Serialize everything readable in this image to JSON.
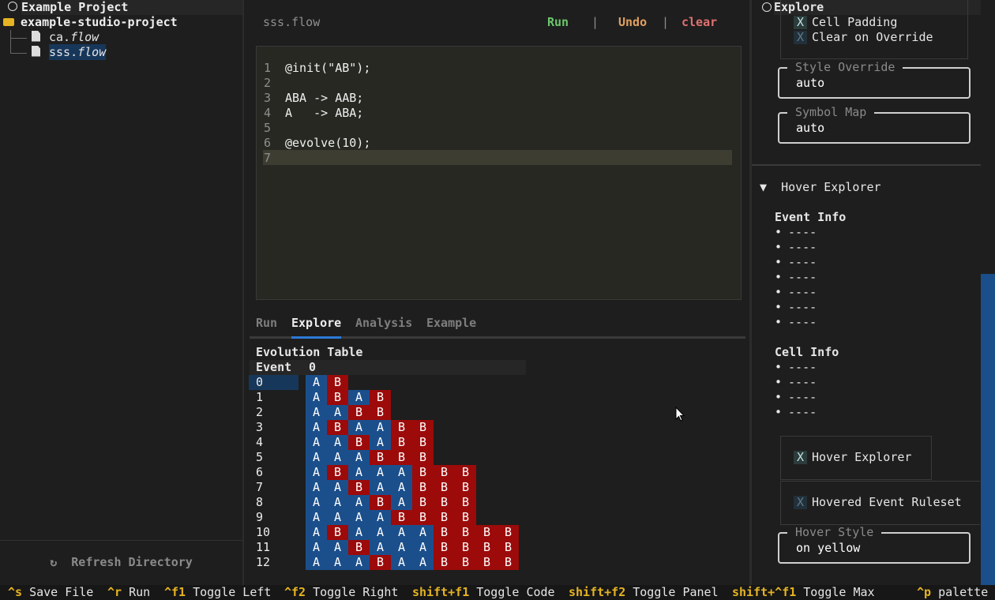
{
  "left": {
    "title": "Example Project",
    "project_folder": "example-studio-project",
    "files": [
      {
        "stem": "ca.",
        "ext": "flow"
      },
      {
        "stem": "sss.",
        "ext": "flow"
      }
    ],
    "refresh_label": "Refresh Directory",
    "refresh_icon": "↻"
  },
  "editor": {
    "filename": "sss.flow",
    "run_label": "Run",
    "separator": "|",
    "undo_label": "Undo",
    "clear_label": "clear",
    "lines": [
      {
        "num": "1",
        "text": "@init(\"AB\");"
      },
      {
        "num": "2",
        "text": ""
      },
      {
        "num": "3",
        "text": "ABA -> AAB;"
      },
      {
        "num": "4",
        "text": "A   -> ABA;"
      },
      {
        "num": "5",
        "text": ""
      },
      {
        "num": "6",
        "text": "@evolve(10);"
      },
      {
        "num": "7",
        "text": ""
      }
    ]
  },
  "tabs": [
    "Run",
    "Explore",
    "Analysis",
    "Example"
  ],
  "active_tab": "Explore",
  "evolution": {
    "title": "Evolution Table",
    "col_event": "Event",
    "col_state": "0",
    "rows": [
      {
        "event": "0",
        "cells": "AB"
      },
      {
        "event": "1",
        "cells": "ABAB"
      },
      {
        "event": "2",
        "cells": "AABB"
      },
      {
        "event": "3",
        "cells": "ABAABB"
      },
      {
        "event": "4",
        "cells": "AABABB"
      },
      {
        "event": "5",
        "cells": "AAABBB"
      },
      {
        "event": "6",
        "cells": "ABAAABBB"
      },
      {
        "event": "7",
        "cells": "AABAABBB"
      },
      {
        "event": "8",
        "cells": "AAABABBB"
      },
      {
        "event": "9",
        "cells": "AAAABBBB"
      },
      {
        "event": "10",
        "cells": "ABAAAABBBB"
      },
      {
        "event": "11",
        "cells": "AABAAABBBB"
      },
      {
        "event": "12",
        "cells": "AAABAABBBB"
      }
    ]
  },
  "right": {
    "title": "Explore",
    "cell_padding": "Cell Padding",
    "clear_on_override": "Clear on Override",
    "style_override_label": "Style Override",
    "style_override_value": "auto",
    "symbol_map_label": "Symbol Map",
    "symbol_map_value": "auto",
    "hover_explorer_header": "Hover Explorer",
    "hover_triangle": "▼",
    "event_info_label": "Event Info",
    "event_info_items": [
      "----",
      "----",
      "----",
      "----",
      "----",
      "----",
      "----"
    ],
    "cell_info_label": "Cell Info",
    "cell_info_items": [
      "----",
      "----",
      "----",
      "----"
    ],
    "bullet": "•",
    "hover_explorer_toggle": "Hover Explorer",
    "hovered_event_ruleset": "Hovered Event Ruleset",
    "hover_style_label": "Hover Style",
    "hover_style_value": "on yellow",
    "x_mark": "X"
  },
  "statusbar": [
    {
      "key": "^s",
      "desc": "Save File"
    },
    {
      "key": "^r",
      "desc": "Run"
    },
    {
      "key": "^f1",
      "desc": "Toggle Left"
    },
    {
      "key": "^f2",
      "desc": "Toggle Right"
    },
    {
      "key": "shift+f1",
      "desc": "Toggle Code"
    },
    {
      "key": "shift+f2",
      "desc": "Toggle Panel"
    },
    {
      "key": "shift+^f1",
      "desc": "Toggle Max"
    },
    {
      "key": "^p",
      "desc": "palette"
    }
  ],
  "colors": {
    "cell_a": "#1b4f8c",
    "cell_b": "#9c0a0a",
    "run": "#6cc66c",
    "undo": "#e0a060",
    "clear": "#e07070",
    "accent": "#2d7ad6"
  }
}
